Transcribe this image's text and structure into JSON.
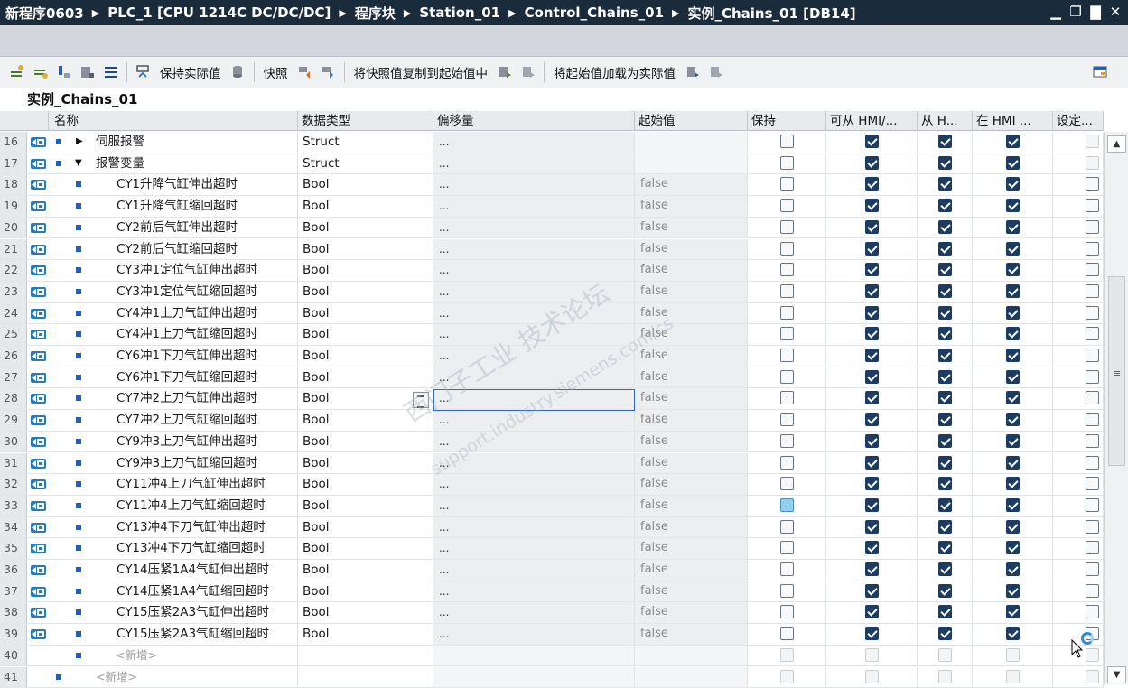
{
  "window": {
    "breadcrumb": [
      "新程序0603",
      "PLC_1 [CPU 1214C DC/DC/DC]",
      "程序块",
      "Station_01",
      "Control_Chains_01",
      "实例_Chains_01 [DB14]"
    ]
  },
  "toolbar": {
    "keep_actual_label": "保持实际值",
    "snapshot_label": "快照",
    "copy_snapshot_label": "将快照值复制到起始值中",
    "load_start_label": "将起始值加载为实际值"
  },
  "db_title": "实例_Chains_01",
  "columns": [
    "名称",
    "数据类型",
    "偏移量",
    "起始值",
    "保持",
    "可从 HMI/...",
    "从 H...",
    "在 HMI ...",
    "设定..."
  ],
  "rows": [
    {
      "num": "16",
      "name": "伺服报警",
      "type": "Struct",
      "offset": "...",
      "start": "",
      "keep": false,
      "hmi1": true,
      "hmi2": true,
      "hmi3": true,
      "setpoint": "disabled",
      "level": 0,
      "expand": "collapsed"
    },
    {
      "num": "17",
      "name": "报警变量",
      "type": "Struct",
      "offset": "...",
      "start": "",
      "keep": false,
      "hmi1": true,
      "hmi2": true,
      "hmi3": true,
      "setpoint": "disabled",
      "level": 0,
      "expand": "expanded"
    },
    {
      "num": "18",
      "name": "CY1升降气缸伸出超时",
      "type": "Bool",
      "offset": "...",
      "start": "false",
      "keep": false,
      "hmi1": true,
      "hmi2": true,
      "hmi3": true,
      "setpoint": "off",
      "level": 1
    },
    {
      "num": "19",
      "name": "CY1升降气缸缩回超时",
      "type": "Bool",
      "offset": "...",
      "start": "false",
      "keep": false,
      "hmi1": true,
      "hmi2": true,
      "hmi3": true,
      "setpoint": "off",
      "level": 1
    },
    {
      "num": "20",
      "name": "CY2前后气缸伸出超时",
      "type": "Bool",
      "offset": "...",
      "start": "false",
      "keep": false,
      "hmi1": true,
      "hmi2": true,
      "hmi3": true,
      "setpoint": "off",
      "level": 1
    },
    {
      "num": "21",
      "name": "CY2前后气缸缩回超时",
      "type": "Bool",
      "offset": "...",
      "start": "false",
      "keep": false,
      "hmi1": true,
      "hmi2": true,
      "hmi3": true,
      "setpoint": "off",
      "level": 1
    },
    {
      "num": "22",
      "name": "CY3冲1定位气缸伸出超时",
      "type": "Bool",
      "offset": "...",
      "start": "false",
      "keep": false,
      "hmi1": true,
      "hmi2": true,
      "hmi3": true,
      "setpoint": "off",
      "level": 1
    },
    {
      "num": "23",
      "name": "CY3冲1定位气缸缩回超时",
      "type": "Bool",
      "offset": "...",
      "start": "false",
      "keep": false,
      "hmi1": true,
      "hmi2": true,
      "hmi3": true,
      "setpoint": "off",
      "level": 1
    },
    {
      "num": "24",
      "name": "CY4冲1上刀气缸伸出超时",
      "type": "Bool",
      "offset": "...",
      "start": "false",
      "keep": false,
      "hmi1": true,
      "hmi2": true,
      "hmi3": true,
      "setpoint": "off",
      "level": 1
    },
    {
      "num": "25",
      "name": "CY4冲1上刀气缸缩回超时",
      "type": "Bool",
      "offset": "...",
      "start": "false",
      "keep": false,
      "hmi1": true,
      "hmi2": true,
      "hmi3": true,
      "setpoint": "off",
      "level": 1
    },
    {
      "num": "26",
      "name": "CY6冲1下刀气缸伸出超时",
      "type": "Bool",
      "offset": "...",
      "start": "false",
      "keep": false,
      "hmi1": true,
      "hmi2": true,
      "hmi3": true,
      "setpoint": "off",
      "level": 1
    },
    {
      "num": "27",
      "name": "CY6冲1下刀气缸缩回超时",
      "type": "Bool",
      "offset": "...",
      "start": "false",
      "keep": false,
      "hmi1": true,
      "hmi2": true,
      "hmi3": true,
      "setpoint": "off",
      "level": 1
    },
    {
      "num": "28",
      "name": "CY7冲2上刀气缸伸出超时",
      "type": "Bool",
      "offset": "...",
      "start": "false",
      "keep": false,
      "hmi1": true,
      "hmi2": true,
      "hmi3": true,
      "setpoint": "off",
      "level": 1,
      "selected": true
    },
    {
      "num": "29",
      "name": "CY7冲2上刀气缸缩回超时",
      "type": "Bool",
      "offset": "...",
      "start": "false",
      "keep": false,
      "hmi1": true,
      "hmi2": true,
      "hmi3": true,
      "setpoint": "off",
      "level": 1
    },
    {
      "num": "30",
      "name": "CY9冲3上刀气缸伸出超时",
      "type": "Bool",
      "offset": "...",
      "start": "false",
      "keep": false,
      "hmi1": true,
      "hmi2": true,
      "hmi3": true,
      "setpoint": "off",
      "level": 1
    },
    {
      "num": "31",
      "name": "CY9冲3上刀气缸缩回超时",
      "type": "Bool",
      "offset": "...",
      "start": "false",
      "keep": false,
      "hmi1": true,
      "hmi2": true,
      "hmi3": true,
      "setpoint": "off",
      "level": 1
    },
    {
      "num": "32",
      "name": "CY11冲4上刀气缸伸出超时",
      "type": "Bool",
      "offset": "...",
      "start": "false",
      "keep": false,
      "hmi1": true,
      "hmi2": true,
      "hmi3": true,
      "setpoint": "off",
      "level": 1
    },
    {
      "num": "33",
      "name": "CY11冲4上刀气缸缩回超时",
      "type": "Bool",
      "offset": "...",
      "start": "false",
      "keep": "blue",
      "hmi1": true,
      "hmi2": true,
      "hmi3": true,
      "setpoint": "off",
      "level": 1
    },
    {
      "num": "34",
      "name": "CY13冲4下刀气缸伸出超时",
      "type": "Bool",
      "offset": "...",
      "start": "false",
      "keep": false,
      "hmi1": true,
      "hmi2": true,
      "hmi3": true,
      "setpoint": "off",
      "level": 1
    },
    {
      "num": "35",
      "name": "CY13冲4下刀气缸缩回超时",
      "type": "Bool",
      "offset": "...",
      "start": "false",
      "keep": false,
      "hmi1": true,
      "hmi2": true,
      "hmi3": true,
      "setpoint": "off",
      "level": 1
    },
    {
      "num": "36",
      "name": "CY14压紧1A4气缸伸出超时",
      "type": "Bool",
      "offset": "...",
      "start": "false",
      "keep": false,
      "hmi1": true,
      "hmi2": true,
      "hmi3": true,
      "setpoint": "off",
      "level": 1
    },
    {
      "num": "37",
      "name": "CY14压紧1A4气缸缩回超时",
      "type": "Bool",
      "offset": "...",
      "start": "false",
      "keep": false,
      "hmi1": true,
      "hmi2": true,
      "hmi3": true,
      "setpoint": "off",
      "level": 1
    },
    {
      "num": "38",
      "name": "CY15压紧2A3气缸伸出超时",
      "type": "Bool",
      "offset": "...",
      "start": "false",
      "keep": false,
      "hmi1": true,
      "hmi2": true,
      "hmi3": true,
      "setpoint": "off",
      "level": 1
    },
    {
      "num": "39",
      "name": "CY15压紧2A3气缸缩回超时",
      "type": "Bool",
      "offset": "...",
      "start": "false",
      "keep": false,
      "hmi1": true,
      "hmi2": true,
      "hmi3": true,
      "setpoint": "off",
      "level": 1
    },
    {
      "num": "40",
      "name": "<新增>",
      "type": "",
      "offset": "",
      "start": "",
      "keep": "disabled",
      "hmi1": "disabled",
      "hmi2": "disabled",
      "hmi3": "disabled",
      "setpoint": "disabled",
      "level": 1,
      "placeholder": true
    },
    {
      "num": "41",
      "name": "<新增>",
      "type": "",
      "offset": "",
      "start": "",
      "keep": "disabled",
      "hmi1": "disabled",
      "hmi2": "disabled",
      "hmi3": "disabled",
      "setpoint": "disabled",
      "level": 0,
      "placeholder": true
    }
  ],
  "watermark": {
    "line1": "西门子工业 技术论坛",
    "line2": "support.industry.siemens.com/cs"
  },
  "colors": {
    "titlebar": "#1a2b3b",
    "checkbox_checked": "#1d3c63",
    "selection": "#2d6ac8",
    "member_square": "#1e5fbf"
  }
}
